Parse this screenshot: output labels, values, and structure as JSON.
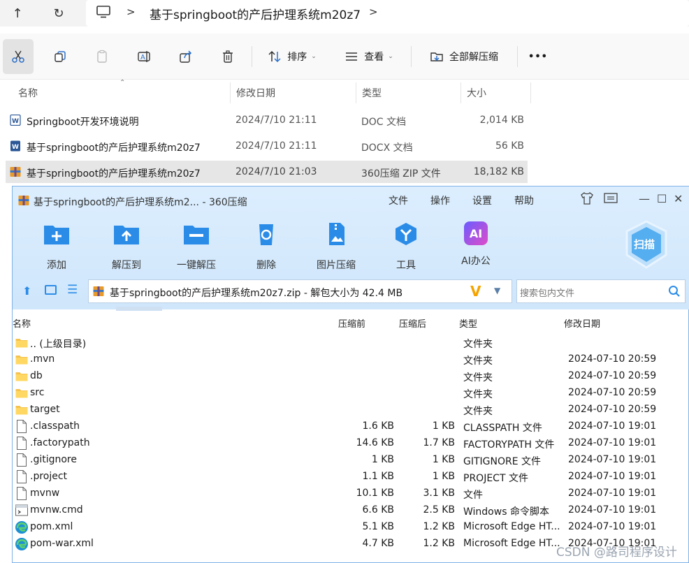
{
  "address": {
    "path": "基于springboot的产后护理系统m20z7"
  },
  "toolbar": {
    "sort_label": "排序",
    "view_label": "查看",
    "extract_all_label": "全部解压缩",
    "more_label": "•••"
  },
  "explorer_columns": {
    "name": "名称",
    "modified": "修改日期",
    "type": "类型",
    "size": "大小"
  },
  "explorer_files": [
    {
      "name": "Springboot开发环境说明",
      "modified": "2024/7/10 21:11",
      "type": "DOC 文档",
      "size": "2,014 KB",
      "icon": "word-doc-icon"
    },
    {
      "name": "基于springboot的产后护理系统m20z7",
      "modified": "2024/7/10 21:11",
      "type": "DOCX 文档",
      "size": "56 KB",
      "icon": "word-docx-icon"
    },
    {
      "name": "基于springboot的产后护理系统m20z7",
      "modified": "2024/7/10 21:03",
      "type": "360压缩 ZIP 文件",
      "size": "18,182 KB",
      "icon": "zip-archive-icon"
    }
  ],
  "zip_window": {
    "title": "基于springboot的产后护理系统m2... - 360压缩",
    "menu": [
      "文件",
      "操作",
      "设置",
      "帮助"
    ],
    "tools": [
      "添加",
      "解压到",
      "一键解压",
      "删除",
      "图片压缩",
      "工具",
      "AI办公"
    ],
    "scan_label": "扫描",
    "ai_label": "AI",
    "address_text": "基于springboot的产后护理系统m20z7.zip - 解包大小为 42.4 MB",
    "search_placeholder": "搜索包内文件",
    "columns": {
      "name": "名称",
      "compressed_before": "压缩前",
      "compressed_after": "压缩后",
      "type": "类型",
      "modified": "修改日期"
    },
    "rows": [
      {
        "name": ".. (上级目录)",
        "before": "",
        "after": "",
        "type": "文件夹",
        "modified": "",
        "icon": "folder"
      },
      {
        "name": ".mvn",
        "before": "",
        "after": "",
        "type": "文件夹",
        "modified": "2024-07-10 20:59",
        "icon": "folder"
      },
      {
        "name": "db",
        "before": "",
        "after": "",
        "type": "文件夹",
        "modified": "2024-07-10 20:59",
        "icon": "folder"
      },
      {
        "name": "src",
        "before": "",
        "after": "",
        "type": "文件夹",
        "modified": "2024-07-10 20:59",
        "icon": "folder"
      },
      {
        "name": "target",
        "before": "",
        "after": "",
        "type": "文件夹",
        "modified": "2024-07-10 20:59",
        "icon": "folder"
      },
      {
        "name": ".classpath",
        "before": "1.6 KB",
        "after": "1 KB",
        "type": "CLASSPATH 文件",
        "modified": "2024-07-10 19:01",
        "icon": "file"
      },
      {
        "name": ".factorypath",
        "before": "14.6 KB",
        "after": "1.7 KB",
        "type": "FACTORYPATH 文件",
        "modified": "2024-07-10 19:01",
        "icon": "file"
      },
      {
        "name": ".gitignore",
        "before": "1 KB",
        "after": "1 KB",
        "type": "GITIGNORE 文件",
        "modified": "2024-07-10 19:01",
        "icon": "file"
      },
      {
        "name": ".project",
        "before": "1.1 KB",
        "after": "1 KB",
        "type": "PROJECT 文件",
        "modified": "2024-07-10 19:01",
        "icon": "file"
      },
      {
        "name": "mvnw",
        "before": "10.1 KB",
        "after": "3.1 KB",
        "type": "文件",
        "modified": "2024-07-10 19:01",
        "icon": "file"
      },
      {
        "name": "mvnw.cmd",
        "before": "6.6 KB",
        "after": "2.5 KB",
        "type": "Windows 命令脚本",
        "modified": "2024-07-10 19:01",
        "icon": "cmd"
      },
      {
        "name": "pom.xml",
        "before": "5.1 KB",
        "after": "1.2 KB",
        "type": "Microsoft Edge HT...",
        "modified": "2024-07-10 19:01",
        "icon": "edge"
      },
      {
        "name": "pom-war.xml",
        "before": "4.7 KB",
        "after": "1.2 KB",
        "type": "Microsoft Edge HT...",
        "modified": "2024-07-10 19:01",
        "icon": "edge"
      }
    ]
  },
  "watermark": "CSDN @路司程序设计",
  "colors": {
    "zip_accent": "#2b8ce8",
    "selection": "#e6e6e6",
    "folder": "#f5c24b"
  }
}
